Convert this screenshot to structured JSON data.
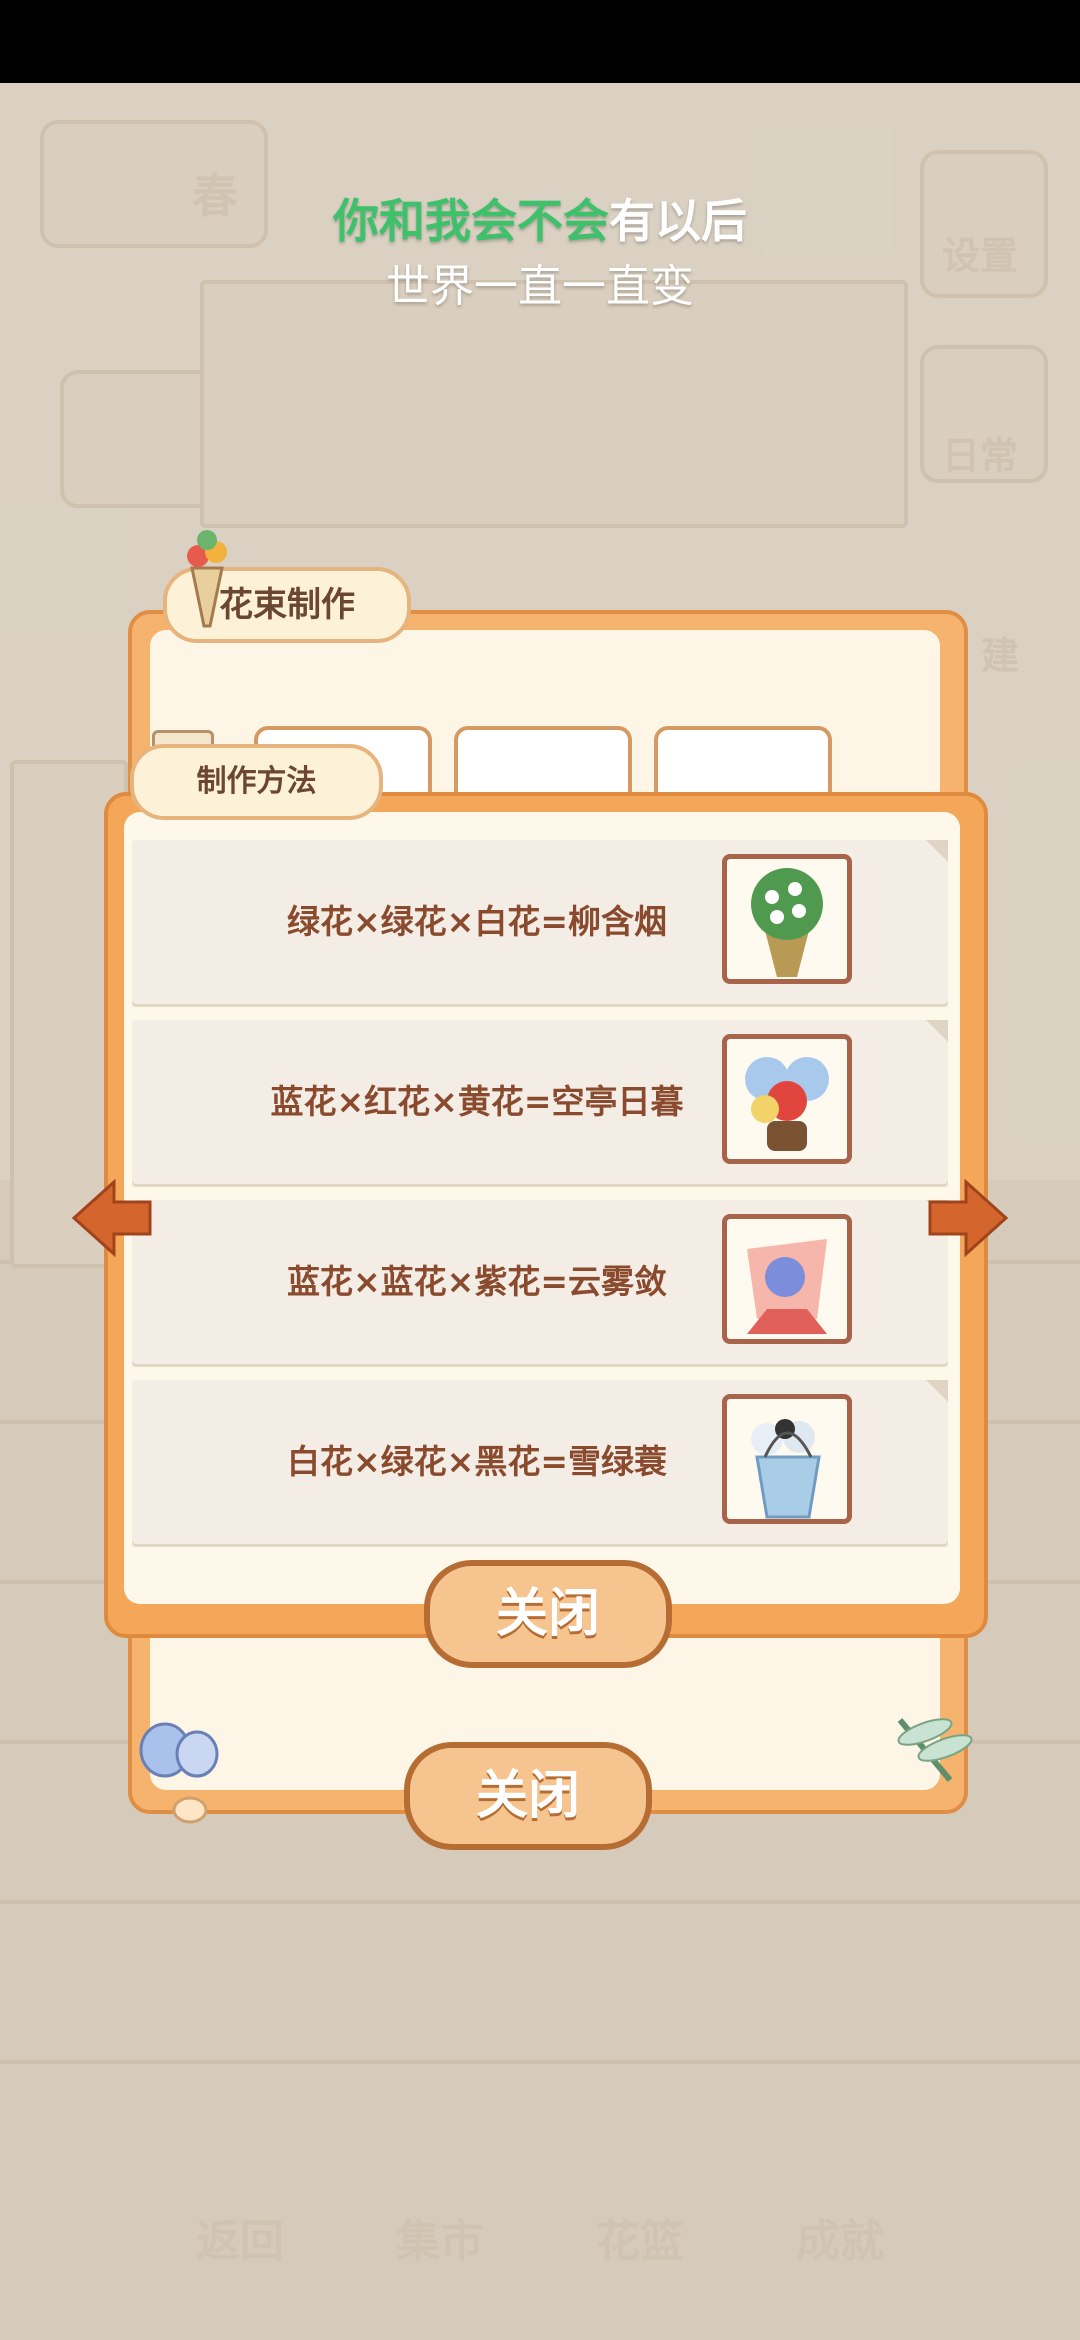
{
  "lyrics": {
    "line1_highlight": "你和我会不会",
    "line1_rest": "有以后",
    "line2": "世界一直一直变"
  },
  "background": {
    "season": "春",
    "settings_label": "设置",
    "daily_label": "日常",
    "build_label": "建",
    "nav": [
      "返回",
      "集市",
      "花篮",
      "成就"
    ]
  },
  "bouquet_panel": {
    "title": "花束制作",
    "close_label": "关闭"
  },
  "recipe_panel": {
    "title": "制作方法",
    "recipes": [
      {
        "text": "绿花×绿花×白花=柳含烟",
        "image": "green-white-bouquet"
      },
      {
        "text": "蓝花×红花×黄花=空亭日暮",
        "image": "blue-red-yellow-bouquet"
      },
      {
        "text": "蓝花×蓝花×紫花=云雾敛",
        "image": "pink-purple-bouquet"
      },
      {
        "text": "白花×绿花×黑花=雪绿蓑",
        "image": "white-green-bag-bouquet"
      }
    ],
    "close_label": "关闭"
  },
  "colors": {
    "accent": "#f4a659",
    "text_brown": "#8a4a2d",
    "highlight_green": "#3fc06a"
  }
}
